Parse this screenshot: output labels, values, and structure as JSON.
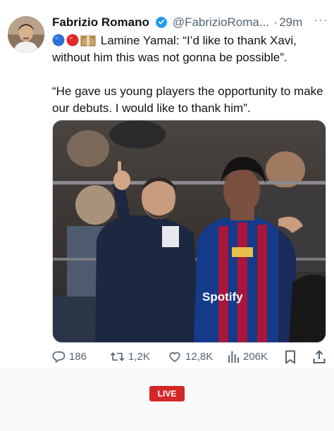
{
  "author": {
    "name": "Fabrizio Romano",
    "handle": "@FabrizioRoma...",
    "separator": "·",
    "time": "29m",
    "verified": true
  },
  "more_icon": "more-dots-icon",
  "tweet": {
    "line1_emojis": [
      "blue-circle",
      "red-circle",
      "package"
    ],
    "line1_text": "Lamine Yamal: “I’d like to thank Xavi, without him this was not gonna be possible”.",
    "line2_text": "“He gave us young players the opportunity to make our debuts. I would like to thank him”."
  },
  "media": {
    "alt": "Xavi pointing while speaking to Lamine Yamal in a Barcelona kit on the sideline",
    "sponsor_text": "Spotify"
  },
  "actions": {
    "reply_count": "186",
    "retweet_count": "1,2K",
    "like_count": "12,8K",
    "view_count": "206K"
  },
  "live_badge": "LIVE",
  "colors": {
    "verified_blue": "#1d9bf0",
    "text_secondary": "#536471",
    "live_red": "#d42727"
  }
}
